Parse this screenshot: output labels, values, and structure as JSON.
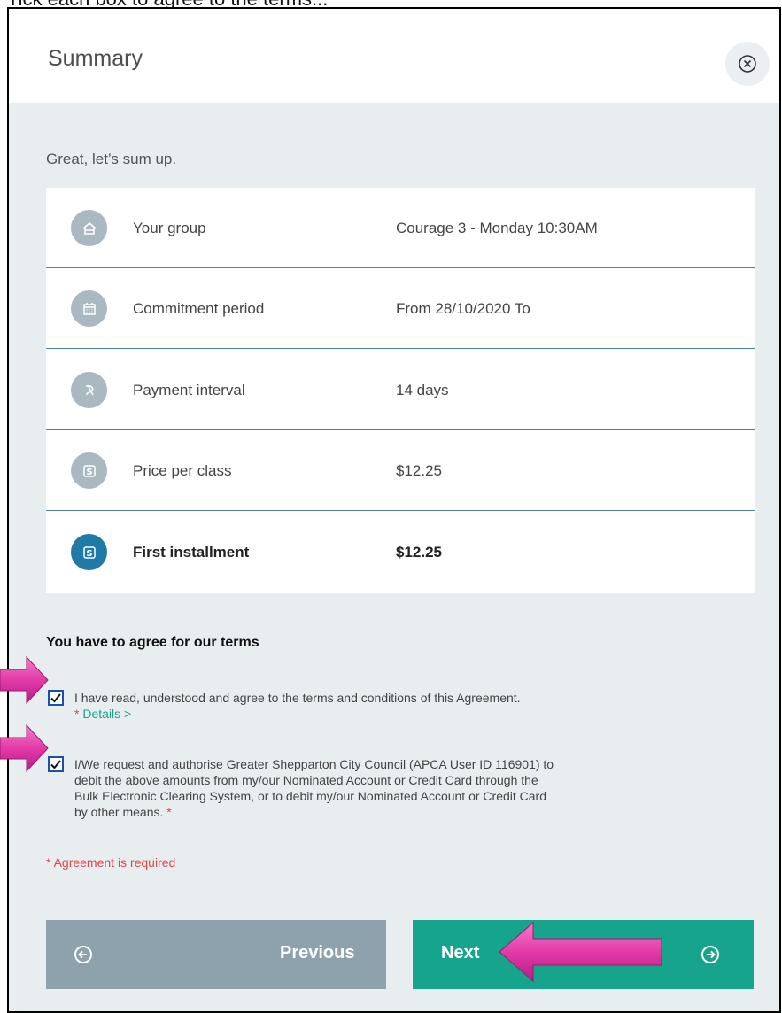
{
  "top_caption": "Tick each box to agree to the terms...",
  "modal": {
    "title": "Summary",
    "close_icon": "close-circle-icon"
  },
  "lead": "Great, let’s sum up.",
  "summary": {
    "rows": [
      {
        "icon": "home-icon",
        "label": "Your group",
        "value": "Courage 3 - Monday 10:30AM"
      },
      {
        "icon": "calendar-icon",
        "label": "Commitment period",
        "value": "From 28/10/2020 To"
      },
      {
        "icon": "payment-interval-icon",
        "label": "Payment interval",
        "value": "14 days"
      },
      {
        "icon": "dollar-icon",
        "label": "Price per class",
        "value": "$12.25"
      },
      {
        "icon": "dollar-icon",
        "label": "First installment",
        "value": "$12.25"
      }
    ]
  },
  "terms": {
    "heading": "You have to agree for our terms",
    "agreement1": {
      "checked": true,
      "text": "I have read, understood and agree to the terms and conditions of this Agreement.",
      "required_mark": "*",
      "details_link": "Details >"
    },
    "agreement2": {
      "checked": true,
      "line1": "I/We request and authorise Greater Shepparton City Council (APCA User ID 116901) to",
      "line2": "debit the above amounts from my/our Nominated Account or Credit Card through the",
      "line3": "Bulk Electronic Clearing System, or to debit my/our Nominated Account or Credit Card",
      "line4": "by other means.",
      "required_mark": "*"
    },
    "error": "* Agreement is required"
  },
  "buttons": {
    "previous": "Previous",
    "next": "Next"
  },
  "colors": {
    "accent": "#16a58c",
    "secondary": "#8ea2ae",
    "required": "#e64545",
    "annotation_arrow": "#e23aa8"
  }
}
